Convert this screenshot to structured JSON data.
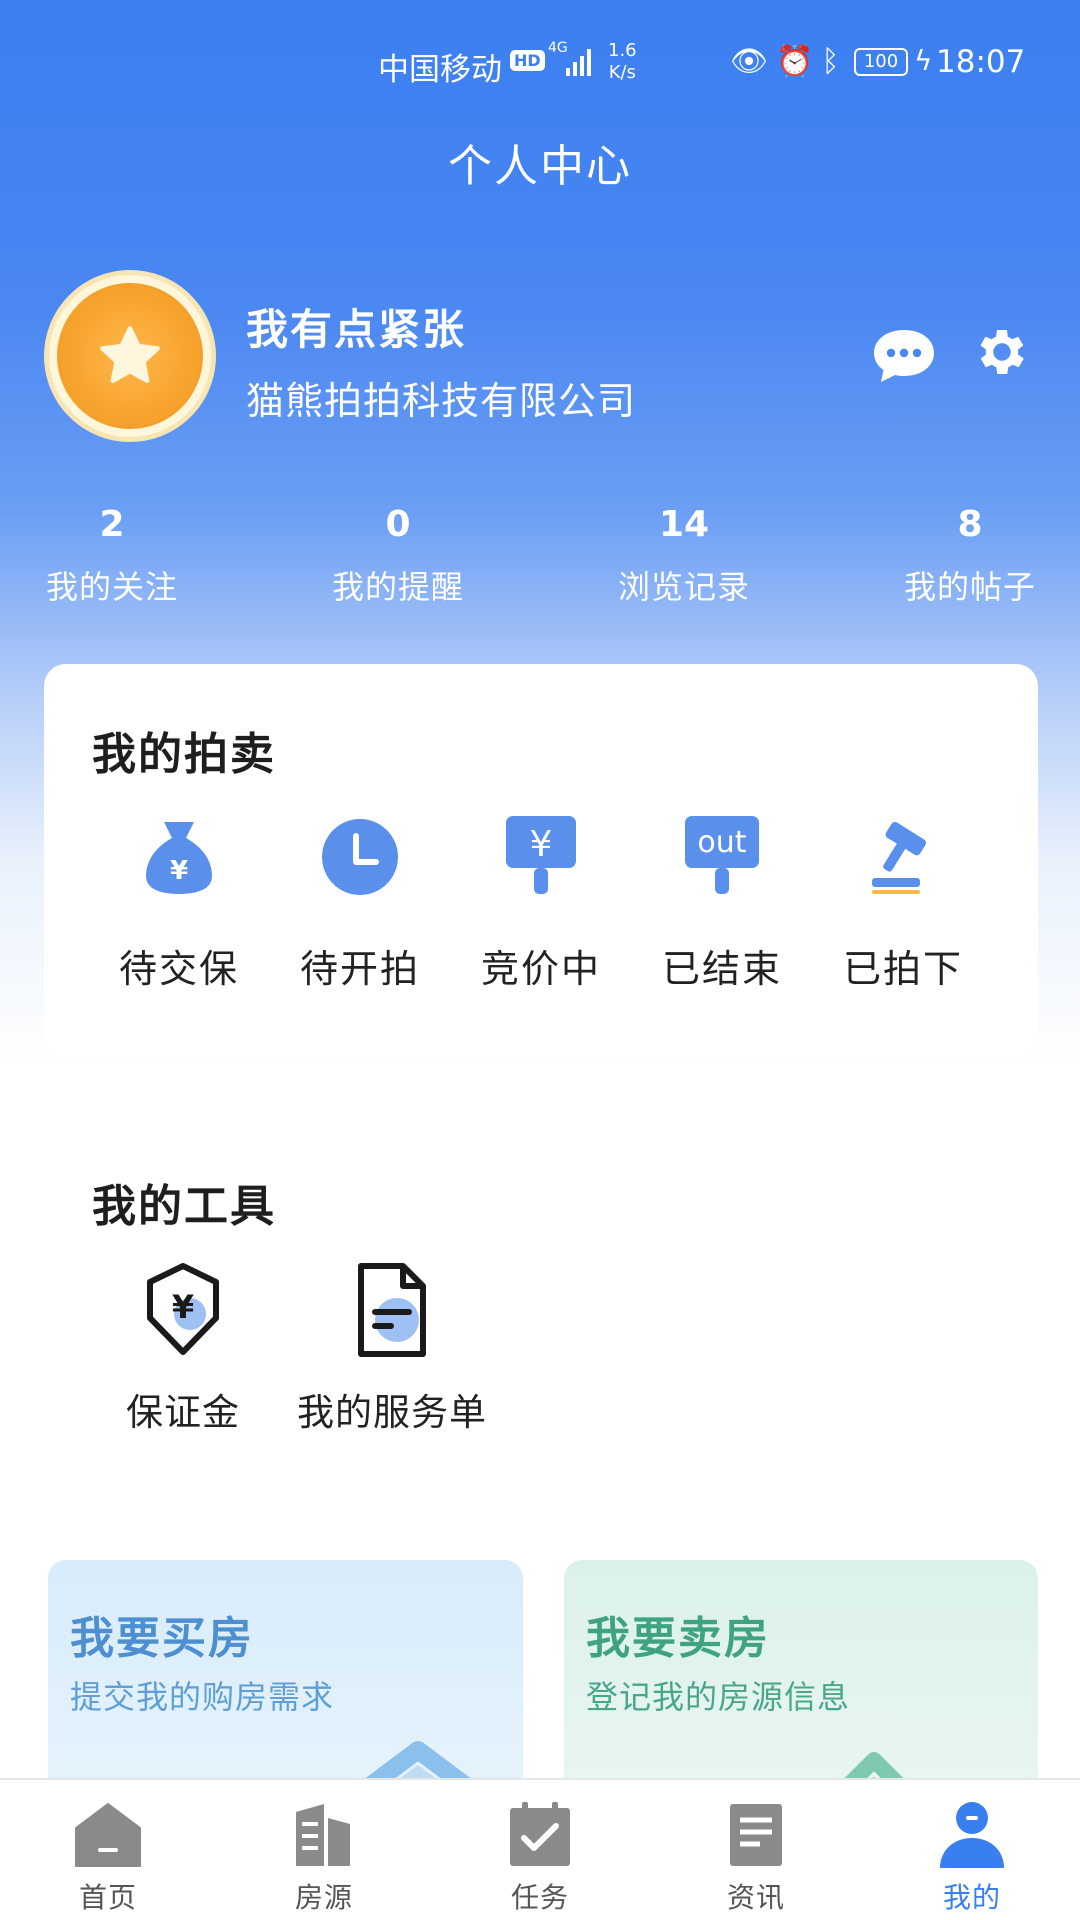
{
  "status_bar": {
    "carrier": "中国移动",
    "hd": "HD",
    "network": "4G",
    "speed_value": "1.6",
    "speed_unit": "K/s",
    "battery": "100",
    "time": "18:07"
  },
  "header": {
    "title": "个人中心"
  },
  "profile": {
    "name": "我有点紧张",
    "company": "猫熊拍拍科技有限公司"
  },
  "stats": [
    {
      "value": "2",
      "label": "我的关注"
    },
    {
      "value": "0",
      "label": "我的提醒"
    },
    {
      "value": "14",
      "label": "浏览记录"
    },
    {
      "value": "8",
      "label": "我的帖子"
    }
  ],
  "auction": {
    "title": "我的拍卖",
    "items": [
      {
        "label": "待交保",
        "icon": "money-bag-icon"
      },
      {
        "label": "待开拍",
        "icon": "clock-icon"
      },
      {
        "label": "竞价中",
        "icon": "yuan-sign-icon"
      },
      {
        "label": "已结束",
        "icon": "out-sign-icon"
      },
      {
        "label": "已拍下",
        "icon": "gavel-icon"
      }
    ],
    "yuan_glyph": "¥",
    "out_text": "out"
  },
  "tools": {
    "title": "我的工具",
    "items": [
      {
        "label": "保证金",
        "icon": "shield-yuan-icon"
      },
      {
        "label": "我的服务单",
        "icon": "document-icon"
      }
    ]
  },
  "promos": {
    "buy": {
      "title": "我要买房",
      "subtitle": "提交我的购房需求"
    },
    "sell": {
      "title": "我要卖房",
      "subtitle": "登记我的房源信息"
    }
  },
  "tabbar": [
    {
      "label": "首页",
      "icon": "home-icon"
    },
    {
      "label": "房源",
      "icon": "buildings-icon"
    },
    {
      "label": "任务",
      "icon": "task-icon"
    },
    {
      "label": "资讯",
      "icon": "news-icon"
    },
    {
      "label": "我的",
      "icon": "user-icon"
    }
  ],
  "colors": {
    "primary": "#3b7ff0",
    "icon_blue": "#5a90ec",
    "active_tab": "#3a7fef",
    "tab_gray": "#8a8a8a",
    "coin_gold": "#f8a52f"
  }
}
